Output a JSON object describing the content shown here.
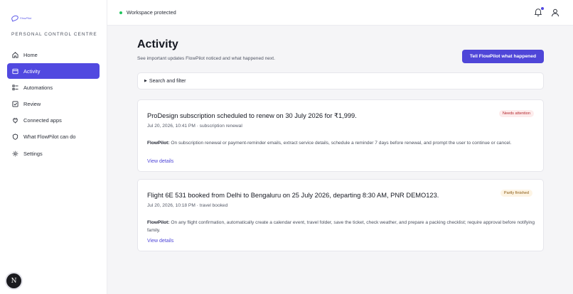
{
  "brand": {
    "logo_text": "FlowPilot"
  },
  "sidebar": {
    "section_label": "PERSONAL CONTROL CENTRE",
    "items": [
      {
        "label": "Home",
        "icon": "home-icon",
        "active": false
      },
      {
        "label": "Activity",
        "icon": "activity-icon",
        "active": true
      },
      {
        "label": "Automations",
        "icon": "automations-icon",
        "active": false
      },
      {
        "label": "Review",
        "icon": "review-icon",
        "active": false
      },
      {
        "label": "Connected apps",
        "icon": "plug-icon",
        "active": false
      },
      {
        "label": "What FlowPilot can do",
        "icon": "shield-icon",
        "active": false
      },
      {
        "label": "Settings",
        "icon": "gear-icon",
        "active": false
      }
    ],
    "footer_avatar": "N"
  },
  "topbar": {
    "status_text": "Workspace protected",
    "status_color": "#22c55e",
    "has_notification": true
  },
  "page": {
    "title": "Activity",
    "subtitle": "See important updates FlowPilot noticed and what happened next.",
    "cta_label": "Tell FlowPilot what happened",
    "filter_label": "Search and filter"
  },
  "cards": [
    {
      "title": "ProDesign subscription scheduled to renew on 30 July 2026 for ₹1,999.",
      "meta": "Jul 20, 2026, 10:41 PM · subscription renewal",
      "badge": "Needs attention",
      "desc_label": "FlowPilot:",
      "desc": "On subscription renewal or payment-reminder emails, extract service details, schedule a reminder 7 days before renewal, and prompt the user to continue or cancel.",
      "link": "View details"
    },
    {
      "title": "Flight 6E 531 booked from Delhi to Bengaluru on 25 July 2026, departing 8:30 AM, PNR DEMO123.",
      "meta": "Jul 20, 2026, 10:18 PM · travel booked",
      "badge": "Partly finished",
      "desc_label": "FlowPilot:",
      "desc": "On any flight confirmation, automatically create a calendar event, travel folder, save the ticket, check weather, and prepare a packing checklist; require approval before notifying family.",
      "link": "View details"
    }
  ],
  "colors": {
    "accent": "#5149e0",
    "background": "#f5f5f7"
  }
}
